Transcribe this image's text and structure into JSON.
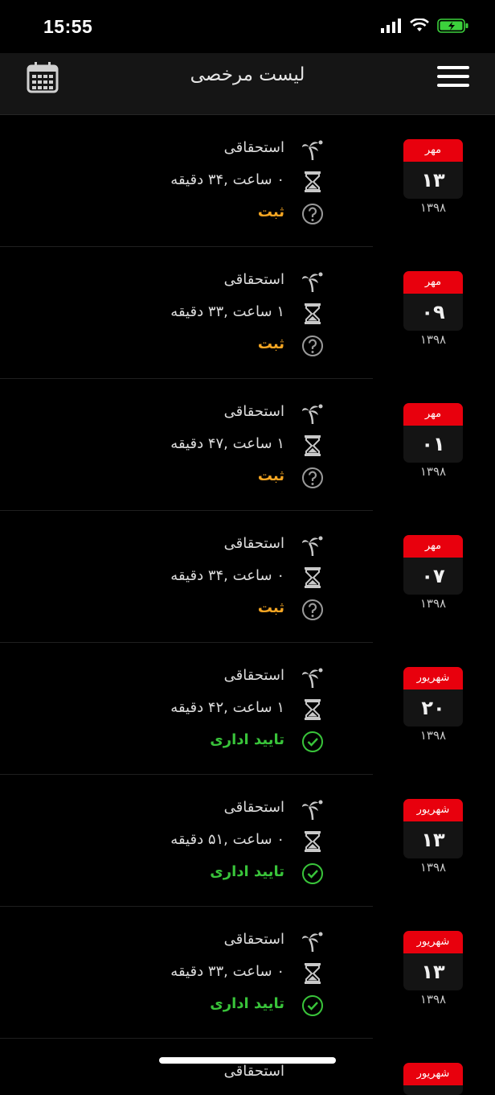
{
  "status_bar": {
    "time": "15:55"
  },
  "header": {
    "title": "لیست مرخصی"
  },
  "rows": [
    {
      "month": "مهر",
      "day": "۱۳",
      "year": "۱۳۹۸",
      "type": "استحقاقی",
      "duration": "۰ ساعت ,۳۴ دقیقه",
      "status": "ثبت",
      "status_kind": "pending"
    },
    {
      "month": "مهر",
      "day": "۰۹",
      "year": "۱۳۹۸",
      "type": "استحقاقی",
      "duration": "۱ ساعت ,۳۳ دقیقه",
      "status": "ثبت",
      "status_kind": "pending"
    },
    {
      "month": "مهر",
      "day": "۰۱",
      "year": "۱۳۹۸",
      "type": "استحقاقی",
      "duration": "۱ ساعت ,۴۷ دقیقه",
      "status": "ثبت",
      "status_kind": "pending"
    },
    {
      "month": "مهر",
      "day": "۰۷",
      "year": "۱۳۹۸",
      "type": "استحقاقی",
      "duration": "۰ ساعت ,۳۴ دقیقه",
      "status": "ثبت",
      "status_kind": "pending"
    },
    {
      "month": "شهریور",
      "day": "۲۰",
      "year": "۱۳۹۸",
      "type": "استحقاقی",
      "duration": "۱ ساعت ,۴۲ دقیقه",
      "status": "تایید اداری",
      "status_kind": "approved"
    },
    {
      "month": "شهریور",
      "day": "۱۳",
      "year": "۱۳۹۸",
      "type": "استحقاقی",
      "duration": "۰ ساعت ,۵۱ دقیقه",
      "status": "تایید اداری",
      "status_kind": "approved"
    },
    {
      "month": "شهریور",
      "day": "۱۳",
      "year": "۱۳۹۸",
      "type": "استحقاقی",
      "duration": "۰ ساعت ,۳۳ دقیقه",
      "status": "تایید اداری",
      "status_kind": "approved"
    }
  ],
  "partial_row": {
    "month": "شهریور",
    "type": "استحقاقی"
  },
  "colors": {
    "pending": "#f5a623",
    "approved": "#39c43a",
    "month_badge": "#e8000d"
  },
  "icons": {
    "type": "palm-tree-icon",
    "duration": "hourglass-icon",
    "pending": "question-circle-icon",
    "approved": "check-circle-icon"
  }
}
